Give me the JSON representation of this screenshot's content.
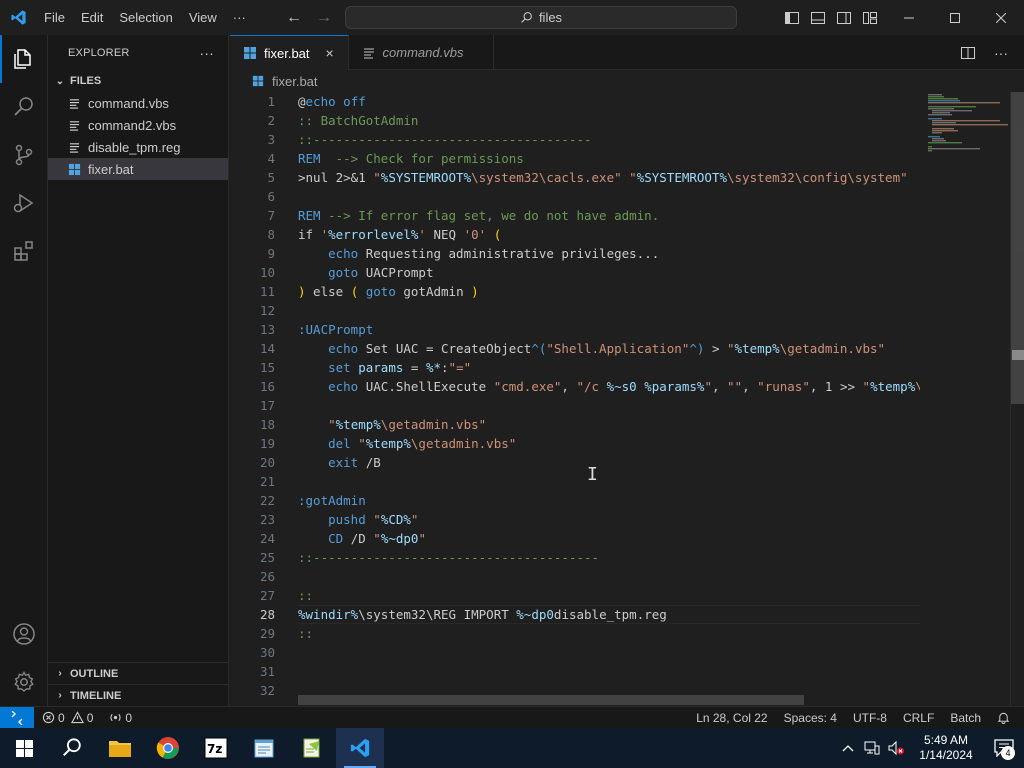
{
  "titlebar": {
    "menu": [
      "File",
      "Edit",
      "Selection",
      "View",
      "···"
    ],
    "search_text": "files"
  },
  "sidebar": {
    "title": "EXPLORER",
    "more_label": "···",
    "section": "FILES",
    "files": [
      {
        "name": "command.vbs",
        "type": "vbs"
      },
      {
        "name": "command2.vbs",
        "type": "vbs"
      },
      {
        "name": "disable_tpm.reg",
        "type": "reg"
      },
      {
        "name": "fixer.bat",
        "type": "bat",
        "selected": true
      }
    ],
    "outline": "OUTLINE",
    "timeline": "TIMELINE"
  },
  "tabs": [
    {
      "label": "fixer.bat",
      "active": true,
      "close": "×"
    },
    {
      "label": "command.vbs",
      "active": false
    }
  ],
  "breadcrumb": "fixer.bat",
  "editor": {
    "current_line": 28,
    "lines": [
      [
        [
          "@",
          "t-plain"
        ],
        [
          "echo",
          "t-kw"
        ],
        [
          " off",
          "t-kw"
        ]
      ],
      [
        [
          ":: BatchGotAdmin",
          "t-cmt"
        ]
      ],
      [
        [
          "::-------------------------------------",
          "t-cmt"
        ]
      ],
      [
        [
          "REM",
          "t-kw"
        ],
        [
          "  --> Check for permissions",
          "t-cmt"
        ]
      ],
      [
        [
          ">nul 2>&1 ",
          "t-plain"
        ],
        [
          "\"",
          "t-str"
        ],
        [
          "%SYSTEMROOT%",
          "t-var"
        ],
        [
          "\\system32\\cacls.exe\" \"",
          "t-str"
        ],
        [
          "%SYSTEMROOT%",
          "t-var"
        ],
        [
          "\\system32\\config\\system\"",
          "t-str"
        ]
      ],
      [],
      [
        [
          "REM",
          "t-kw"
        ],
        [
          " --> If error flag set, we do not have admin.",
          "t-cmt"
        ]
      ],
      [
        [
          "if ",
          "t-plain"
        ],
        [
          "'",
          "t-str"
        ],
        [
          "%errorlevel%",
          "t-var"
        ],
        [
          "'",
          "t-str"
        ],
        [
          " NEQ ",
          "t-plain"
        ],
        [
          "'0'",
          "t-str"
        ],
        [
          " ",
          "t-plain"
        ],
        [
          "(",
          "t-brk"
        ]
      ],
      [
        [
          "    ",
          "t-plain"
        ],
        [
          "echo",
          "t-kw"
        ],
        [
          " Requesting administrative privileges...",
          "t-plain"
        ]
      ],
      [
        [
          "    ",
          "t-plain"
        ],
        [
          "goto",
          "t-kw"
        ],
        [
          " UACPrompt",
          "t-plain"
        ]
      ],
      [
        [
          ")",
          "t-brk"
        ],
        [
          " else ",
          "t-plain"
        ],
        [
          "(",
          "t-brk"
        ],
        [
          " ",
          "t-plain"
        ],
        [
          "goto",
          "t-kw"
        ],
        [
          " gotAdmin ",
          "t-plain"
        ],
        [
          ")",
          "t-brk"
        ]
      ],
      [],
      [
        [
          ":UACPrompt",
          "t-label"
        ]
      ],
      [
        [
          "    ",
          "t-plain"
        ],
        [
          "echo",
          "t-kw"
        ],
        [
          " Set UAC = CreateObject",
          "t-plain"
        ],
        [
          "^(",
          "t-kw"
        ],
        [
          "\"Shell.Application\"",
          "t-str"
        ],
        [
          "^)",
          "t-kw"
        ],
        [
          " > ",
          "t-plain"
        ],
        [
          "\"",
          "t-str"
        ],
        [
          "%temp%",
          "t-var"
        ],
        [
          "\\getadmin.vbs\"",
          "t-str"
        ]
      ],
      [
        [
          "    ",
          "t-plain"
        ],
        [
          "set",
          "t-kw"
        ],
        [
          " ",
          "t-plain"
        ],
        [
          "params",
          "t-var"
        ],
        [
          " = ",
          "t-plain"
        ],
        [
          "%*",
          "t-var"
        ],
        [
          ":",
          "t-plain"
        ],
        [
          "\"=\"",
          "t-str"
        ]
      ],
      [
        [
          "    ",
          "t-plain"
        ],
        [
          "echo",
          "t-kw"
        ],
        [
          " UAC.ShellExecute ",
          "t-plain"
        ],
        [
          "\"cmd.exe\"",
          "t-str"
        ],
        [
          ", ",
          "t-plain"
        ],
        [
          "\"/c ",
          "t-str"
        ],
        [
          "%~s0",
          "t-var"
        ],
        [
          " ",
          "t-str"
        ],
        [
          "%params%",
          "t-var"
        ],
        [
          "\"",
          "t-str"
        ],
        [
          ", ",
          "t-plain"
        ],
        [
          "\"\"",
          "t-str"
        ],
        [
          ", ",
          "t-plain"
        ],
        [
          "\"runas\"",
          "t-str"
        ],
        [
          ", 1 >> ",
          "t-plain"
        ],
        [
          "\"",
          "t-str"
        ],
        [
          "%temp%",
          "t-var"
        ],
        [
          "\\getadmin.vbs\"",
          "t-str"
        ]
      ],
      [],
      [
        [
          "    ",
          "t-plain"
        ],
        [
          "\"",
          "t-str"
        ],
        [
          "%temp%",
          "t-var"
        ],
        [
          "\\getadmin.vbs\"",
          "t-str"
        ]
      ],
      [
        [
          "    ",
          "t-plain"
        ],
        [
          "del",
          "t-kw"
        ],
        [
          " ",
          "t-plain"
        ],
        [
          "\"",
          "t-str"
        ],
        [
          "%temp%",
          "t-var"
        ],
        [
          "\\getadmin.vbs\"",
          "t-str"
        ]
      ],
      [
        [
          "    ",
          "t-plain"
        ],
        [
          "exit",
          "t-kw"
        ],
        [
          " /B",
          "t-plain"
        ]
      ],
      [],
      [
        [
          ":gotAdmin",
          "t-label"
        ]
      ],
      [
        [
          "    ",
          "t-plain"
        ],
        [
          "pushd",
          "t-kw"
        ],
        [
          " ",
          "t-plain"
        ],
        [
          "\"",
          "t-str"
        ],
        [
          "%CD%",
          "t-var"
        ],
        [
          "\"",
          "t-str"
        ]
      ],
      [
        [
          "    ",
          "t-plain"
        ],
        [
          "CD",
          "t-kw"
        ],
        [
          " /D ",
          "t-plain"
        ],
        [
          "\"",
          "t-str"
        ],
        [
          "%~dp0",
          "t-var"
        ],
        [
          "\"",
          "t-str"
        ]
      ],
      [
        [
          "::--------------------------------------",
          "t-cmt"
        ]
      ],
      [],
      [
        [
          "::",
          "t-cmt"
        ]
      ],
      [
        [
          "%windir%",
          "t-var"
        ],
        [
          "\\system32\\",
          "t-plain"
        ],
        [
          "REG",
          "t-plain"
        ],
        [
          " IMPORT ",
          "t-plain"
        ],
        [
          "%~dp0",
          "t-var"
        ],
        [
          "disable_tpm.reg",
          "t-plain"
        ]
      ],
      [
        [
          "::",
          "t-cmt"
        ]
      ],
      [],
      [],
      []
    ]
  },
  "statusbar": {
    "errors": "0",
    "warnings": "0",
    "ports": "0",
    "position": "Ln 28, Col 22",
    "spaces": "Spaces: 4",
    "encoding": "UTF-8",
    "eol": "CRLF",
    "language": "Batch"
  },
  "taskbar": {
    "time": "5:49 AM",
    "date": "1/14/2024",
    "notifications": "4"
  },
  "colors": {
    "accent": "#0078d4",
    "editor_bg": "#1f1f1f",
    "keyword": "#569cd6",
    "comment": "#6a9955",
    "string": "#ce9178",
    "variable": "#9cdcfe"
  }
}
